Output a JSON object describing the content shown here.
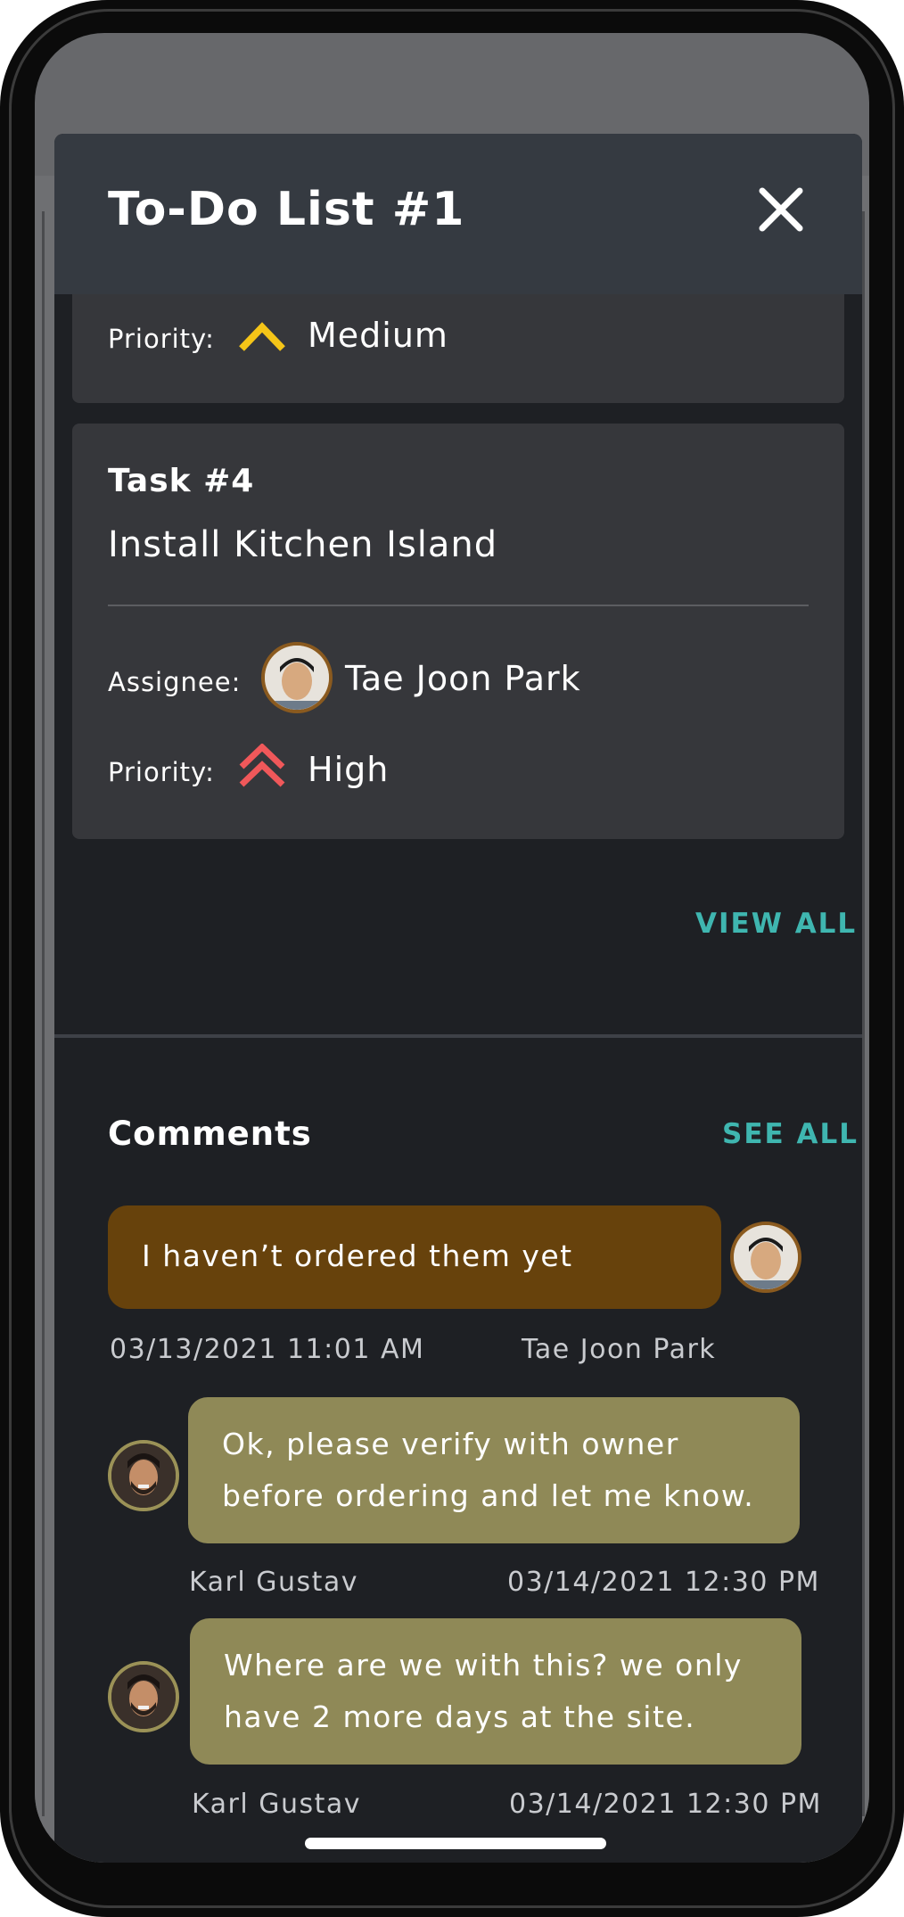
{
  "header": {
    "title": "To-Do List #1",
    "close_icon": "close-icon"
  },
  "previous_task": {
    "priority_label": "Priority:",
    "priority_value": "Medium",
    "priority_color": "#f5c518"
  },
  "task": {
    "number": "Task #4",
    "name": "Install Kitchen Island",
    "assignee_label": "Assignee:",
    "assignee_name": "Tae Joon Park",
    "priority_label": "Priority:",
    "priority_value": "High",
    "priority_color": "#f0585a"
  },
  "view_all_label": "VIEW ALL",
  "comments": {
    "title": "Comments",
    "see_all_label": "SEE ALL",
    "items": [
      {
        "text": "I haven’t ordered them yet",
        "date": "03/13/2021 11:01 AM",
        "author": "Tae Joon Park",
        "own": true
      },
      {
        "text_line1": "Ok, please verify with owner",
        "text_line2": "before ordering and let me know.",
        "author": "Karl Gustav",
        "date": "03/14/2021 12:30 PM",
        "own": false
      },
      {
        "text_line1": "Where are we with this? we only",
        "text_line2": "have 2 more days at the site.",
        "author": "Karl Gustav",
        "date": "03/14/2021 12:30 PM",
        "own": false
      }
    ]
  },
  "colors": {
    "accent": "#3fb6b0",
    "own_bubble": "#67420c",
    "other_bubble": "#8f8957",
    "header": "#353a41",
    "card": "#36373b"
  }
}
